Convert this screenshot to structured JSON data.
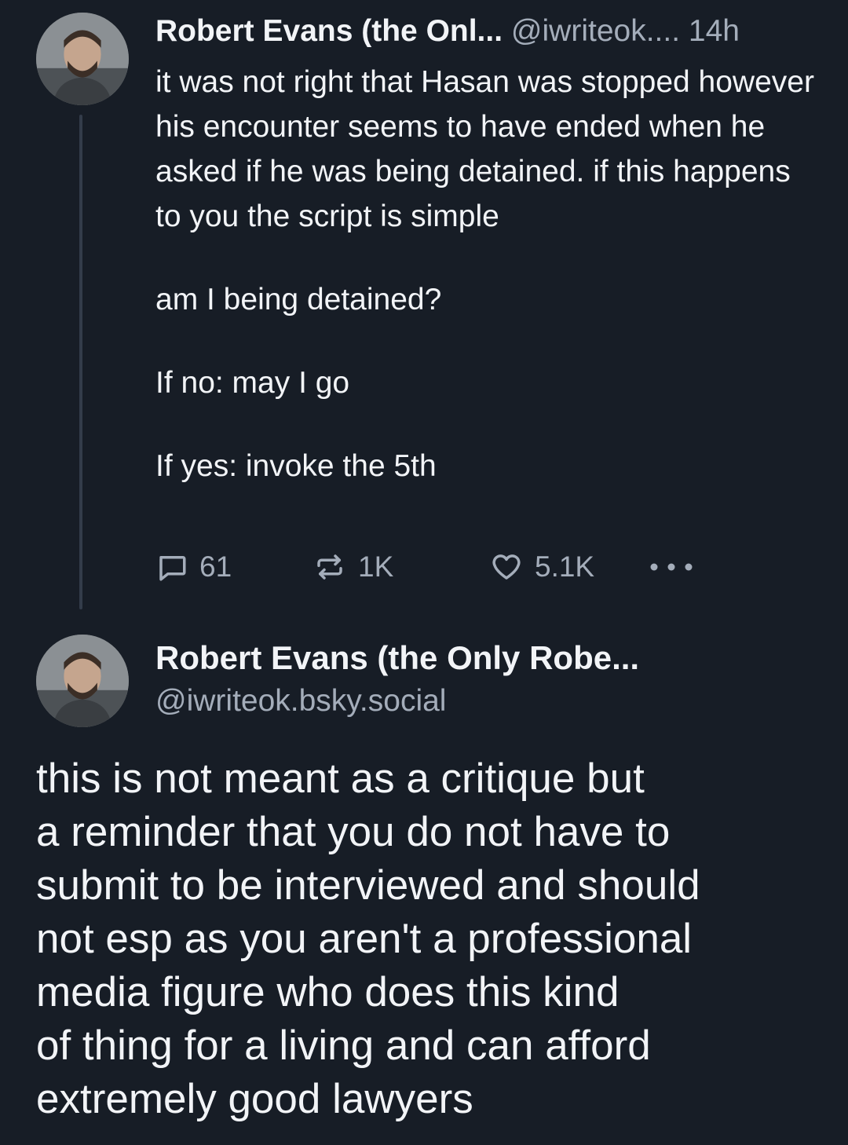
{
  "parent_post": {
    "author_name": "Robert Evans (the Onl...",
    "handle": "@iwriteok....",
    "time": "14h",
    "body": [
      "it was not right that Hasan was stopped however his encounter seems to have ended when he asked if he was being detained. if this happens to you the script is simple",
      "am I being detained?",
      "If no: may I go",
      "If yes: invoke the 5th"
    ],
    "actions": {
      "reply_count": "61",
      "repost_count": "1K",
      "like_count": "5.1K"
    }
  },
  "main_post": {
    "author_name": "Robert Evans (the Only Robe...",
    "handle": "@iwriteok.bsky.social",
    "body_lines": [
      "this is not meant as a critique but",
      "a reminder that you do not have to",
      "submit to be interviewed and should",
      "not esp as you aren't a professional",
      "media figure who does this kind",
      "of thing for a living and can afford",
      "extremely good lawyers"
    ]
  },
  "colors": {
    "background": "#171d26",
    "text": "#f2f4f7",
    "muted": "#a4adba",
    "thread_line": "#333c4a"
  }
}
